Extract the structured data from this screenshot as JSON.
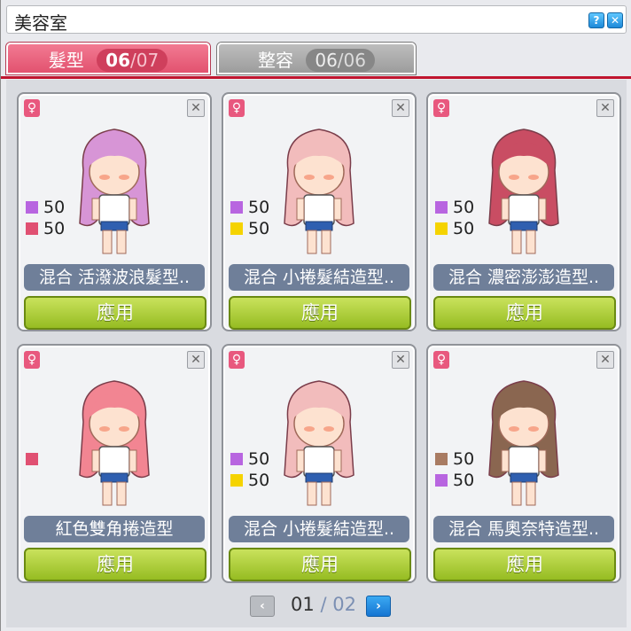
{
  "window": {
    "title": "美容室"
  },
  "tabs": [
    {
      "label": "髮型",
      "current": "06",
      "sep": "/",
      "total": "07"
    },
    {
      "label": "整容",
      "current": "06",
      "sep": "/",
      "total": "06"
    }
  ],
  "cards": [
    {
      "gender_icon": "female-icon",
      "swatches": [
        {
          "color": "#b865e0",
          "value": "50"
        },
        {
          "color": "#e05072",
          "value": "50"
        }
      ],
      "name": "混合 活潑波浪髮型..",
      "apply": "應用",
      "hair_color": "#d795d6"
    },
    {
      "gender_icon": "female-icon",
      "swatches": [
        {
          "color": "#b865e0",
          "value": "50"
        },
        {
          "color": "#f5d300",
          "value": "50"
        }
      ],
      "name": "混合 小捲髮結造型..",
      "apply": "應用",
      "hair_color": "#f2bcbc"
    },
    {
      "gender_icon": "female-icon",
      "swatches": [
        {
          "color": "#b865e0",
          "value": "50"
        },
        {
          "color": "#f5d300",
          "value": "50"
        }
      ],
      "name": "混合 濃密澎澎造型..",
      "apply": "應用",
      "hair_color": "#c94d63"
    },
    {
      "gender_icon": "female-icon",
      "swatches": [
        {
          "color": "#e05072",
          "value": ""
        }
      ],
      "name": "紅色雙角捲造型",
      "apply": "應用",
      "hair_color": "#f28592"
    },
    {
      "gender_icon": "female-icon",
      "swatches": [
        {
          "color": "#b865e0",
          "value": "50"
        },
        {
          "color": "#f5d300",
          "value": "50"
        }
      ],
      "name": "混合 小捲髮結造型..",
      "apply": "應用",
      "hair_color": "#f2bcbc"
    },
    {
      "gender_icon": "female-icon",
      "swatches": [
        {
          "color": "#a87b62",
          "value": "50"
        },
        {
          "color": "#b865e0",
          "value": "50"
        }
      ],
      "name": "混合 馬奧奈特造型..",
      "apply": "應用",
      "hair_color": "#8a6650"
    }
  ],
  "pager": {
    "current": "01",
    "sep": "/",
    "total": "02"
  }
}
